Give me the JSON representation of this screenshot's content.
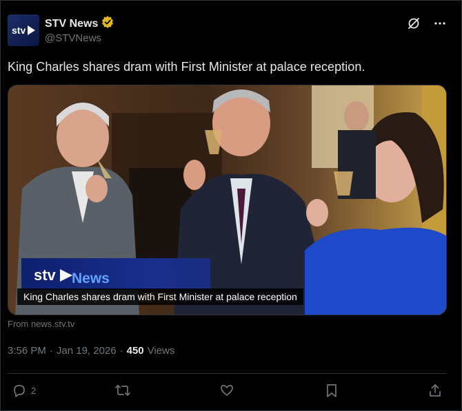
{
  "author": {
    "display_name": "STV News",
    "handle": "@STVNews",
    "verified_badge_color": "#e2b719",
    "avatar_logo": "stv"
  },
  "tweet": {
    "text": "King Charles shares dram with First Minister at palace reception."
  },
  "media": {
    "logo_brand": "stv",
    "logo_text": "News",
    "caption": "King Charles shares dram with First Minister at palace reception"
  },
  "link": {
    "from": "From news.stv.tv"
  },
  "meta": {
    "time": "3:56 PM",
    "separator": "·",
    "date": "Jan 19, 2026",
    "separator2": "·",
    "views_count": "450",
    "views_label": "Views"
  },
  "actions": {
    "reply_count": "2"
  },
  "colors": {
    "background": "#000000",
    "text_primary": "#e7e9ea",
    "text_secondary": "#71767b",
    "border": "#2f3336",
    "stv_blue": "#1a2f8e"
  },
  "icons": [
    "grok-icon",
    "more-icon",
    "verified-badge-icon",
    "reply-icon",
    "retweet-icon",
    "like-icon",
    "bookmark-icon",
    "share-icon"
  ]
}
